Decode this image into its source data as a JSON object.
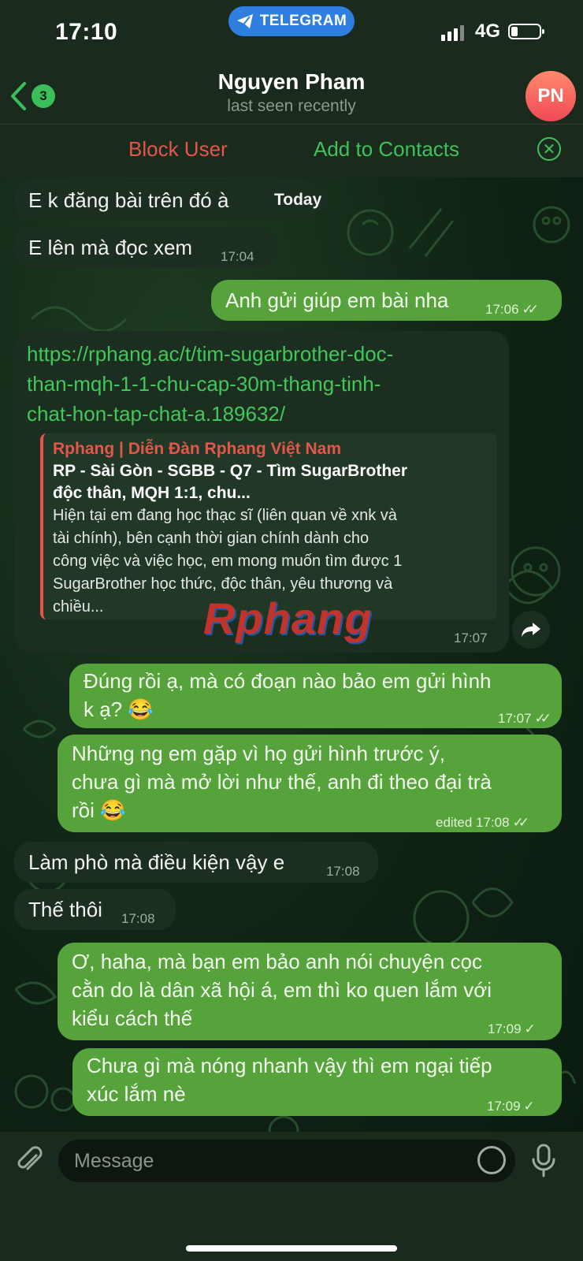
{
  "status": {
    "time": "17:10",
    "app_pill": "TELEGRAM",
    "network": "4G"
  },
  "header": {
    "back_badge": "3",
    "name": "Nguyen Pham",
    "last_seen": "last seen recently",
    "avatar_initials": "PN"
  },
  "actions": {
    "block": "Block User",
    "add": "Add to Contacts"
  },
  "colors": {
    "incoming": "#1c2e1f",
    "outgoing": "#55a33a",
    "link": "#43c65a",
    "block": "#e5564a",
    "accent": "#3fc25a"
  },
  "messages": {
    "m1": {
      "text": "E k đăng bài trên đó à",
      "pill": "Today"
    },
    "m2": {
      "text": "E lên mà đọc xem",
      "time": "17:04"
    },
    "m3": {
      "text": "Anh gửi giúp em bài nha",
      "time": "17:06"
    },
    "m4": {
      "link": "https://rphang.ac/t/tim-sugarbrother-doc-than-mqh-1-1-chu-cap-30m-thang-tinh-chat-hon-tap-chat-a.189632/",
      "link_lines": [
        "https://rphang.ac/t/tim-sugarbrother-doc-",
        "than-mqh-1-1-chu-cap-30m-thang-tinh-",
        "chat-hon-tap-chat-a.189632/"
      ],
      "preview_site": "Rphang | Diễn Đàn Rphang Việt Nam",
      "preview_title_lines": [
        "RP - Sài Gòn - SGBB - Q7 - Tìm SugarBrother",
        "độc thân, MQH 1:1, chu..."
      ],
      "preview_desc_lines": [
        "Hiện tại em đang học thạc sĩ (liên quan về xnk và",
        "tài chính), bên cạnh thời gian chính dành cho",
        "công việc và việc học, em mong muốn tìm được 1",
        "SugarBrother học thức, độc thân, yêu thương và",
        "chiều..."
      ],
      "watermark": "Rphang",
      "time": "17:07"
    },
    "m5": {
      "lines": [
        "Đúng rồi ạ, mà có đoạn nào bảo em gửi hình",
        "k ạ? 😂"
      ],
      "time": "17:07"
    },
    "m6": {
      "lines": [
        "Những ng em gặp vì họ gửi hình trước ý,",
        "chưa gì mà mở lời như thế, anh đi theo đại trà",
        "rồi 😂"
      ],
      "time": "edited 17:08"
    },
    "m7": {
      "text": "Làm phò mà điều kiện vậy e",
      "time": "17:08"
    },
    "m8": {
      "text": "Thế thôi",
      "time": "17:08"
    },
    "m9": {
      "lines": [
        "Ơ, haha, mà bạn em bảo anh nói chuyện cọc",
        "cằn do là dân xã hội á, em thì ko quen lắm với",
        "kiểu cách thế"
      ],
      "time": "17:09"
    },
    "m10": {
      "lines": [
        "Chưa gì mà nóng nhanh vậy thì em ngại tiếp",
        "xúc lắm nè"
      ],
      "time": "17:09"
    }
  },
  "composer": {
    "placeholder": "Message"
  }
}
